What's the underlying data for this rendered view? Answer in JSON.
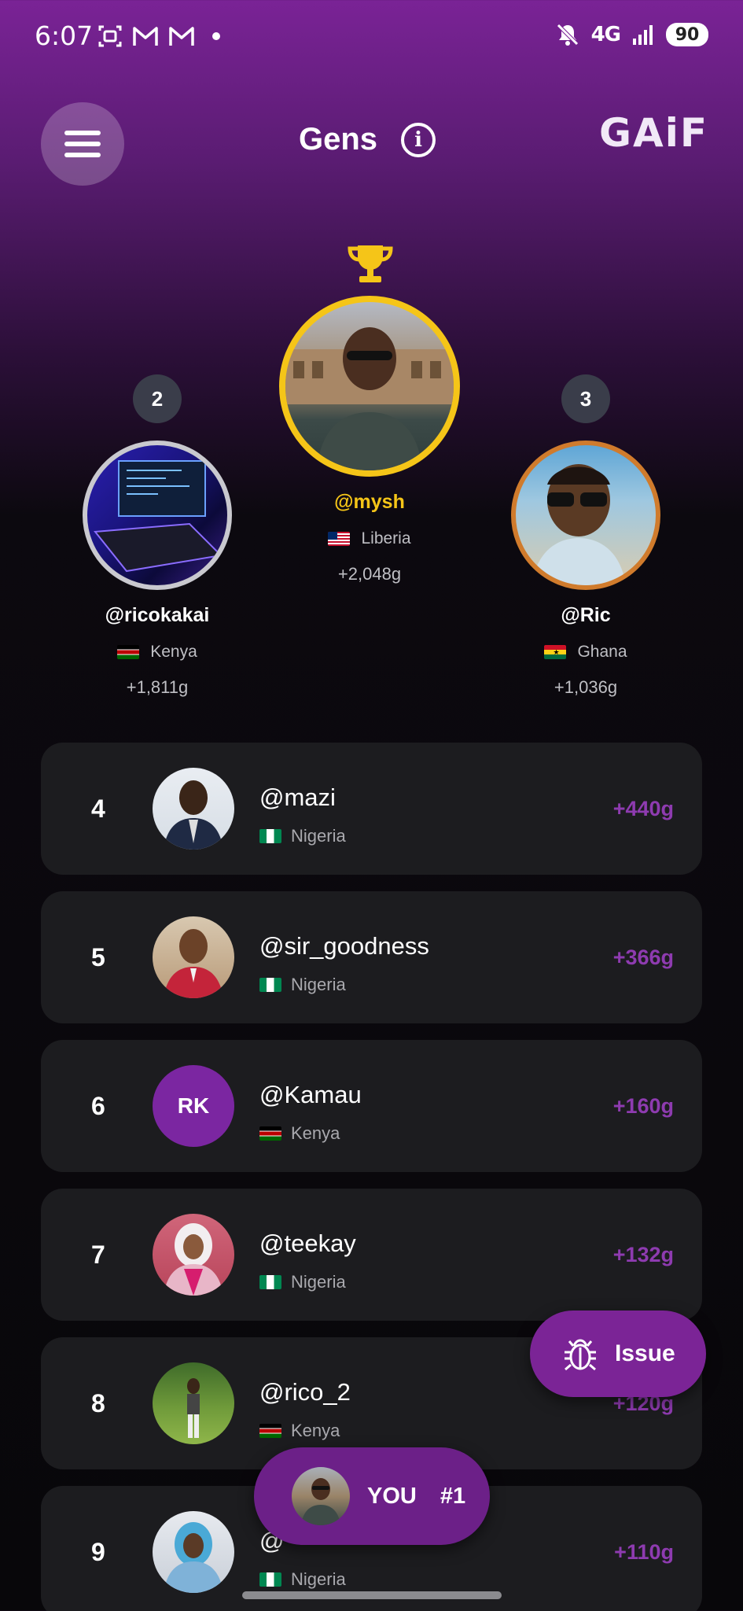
{
  "status_bar": {
    "time": "6:07",
    "network": "4G",
    "battery": "90"
  },
  "header": {
    "title": "Gens",
    "brand": "GAiF",
    "menu_icon": "hamburger-menu-icon",
    "info_icon": "info-icon"
  },
  "podium": {
    "first": {
      "rank": "1",
      "handle": "@mysh",
      "country": "Liberia",
      "points": "+2,048g",
      "flag": "liberia"
    },
    "second": {
      "rank": "2",
      "handle": "@ricokakai",
      "country": "Kenya",
      "points": "+1,811g",
      "flag": "kenya"
    },
    "third": {
      "rank": "3",
      "handle": "@Ric",
      "country": "Ghana",
      "points": "+1,036g",
      "flag": "ghana"
    }
  },
  "leaderboard": [
    {
      "rank": "4",
      "handle": "@mazi",
      "country": "Nigeria",
      "points": "+440g",
      "flag": "nigeria"
    },
    {
      "rank": "5",
      "handle": "@sir_goodness",
      "country": "Nigeria",
      "points": "+366g",
      "flag": "nigeria"
    },
    {
      "rank": "6",
      "handle": "@Kamau",
      "country": "Kenya",
      "points": "+160g",
      "flag": "kenya",
      "initials": "RK"
    },
    {
      "rank": "7",
      "handle": "@teekay",
      "country": "Nigeria",
      "points": "+132g",
      "flag": "nigeria"
    },
    {
      "rank": "8",
      "handle": "@rico_2",
      "country": "Kenya",
      "points": "+120g",
      "flag": "kenya"
    },
    {
      "rank": "9",
      "handle": "@",
      "country": "Nigeria",
      "points": "+110g",
      "flag": "nigeria"
    }
  ],
  "issue_button": {
    "label": "Issue",
    "icon": "bug-icon"
  },
  "you_pill": {
    "label": "YOU",
    "rank": "#1"
  },
  "colors": {
    "accent": "#7b2496",
    "gold": "#f5c518",
    "silver": "#c9c9cf",
    "bronze": "#d07b2c",
    "points": "#8e3bb0"
  }
}
